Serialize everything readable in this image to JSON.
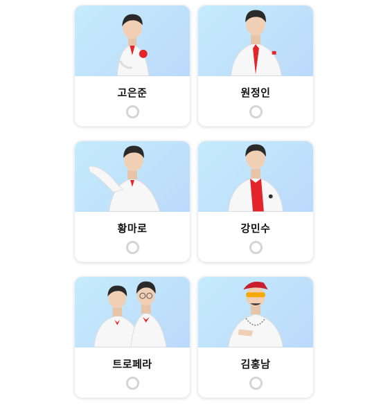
{
  "candidates": [
    {
      "name": "고은준",
      "selected": false,
      "photo_icon": "person-photo"
    },
    {
      "name": "원정인",
      "selected": false,
      "photo_icon": "person-photo"
    },
    {
      "name": "황마로",
      "selected": false,
      "photo_icon": "person-photo"
    },
    {
      "name": "강민수",
      "selected": false,
      "photo_icon": "person-photo"
    },
    {
      "name": "트로페라",
      "selected": false,
      "photo_icon": "duo-photo"
    },
    {
      "name": "김홍남",
      "selected": false,
      "photo_icon": "person-photo"
    }
  ],
  "colors": {
    "photo_bg_start": "#c4ecfb",
    "photo_bg_end": "#bcd9fb",
    "suit": "#f7f7f7",
    "accent_red": "#e3242b",
    "radio_border": "#d4d4d4"
  }
}
